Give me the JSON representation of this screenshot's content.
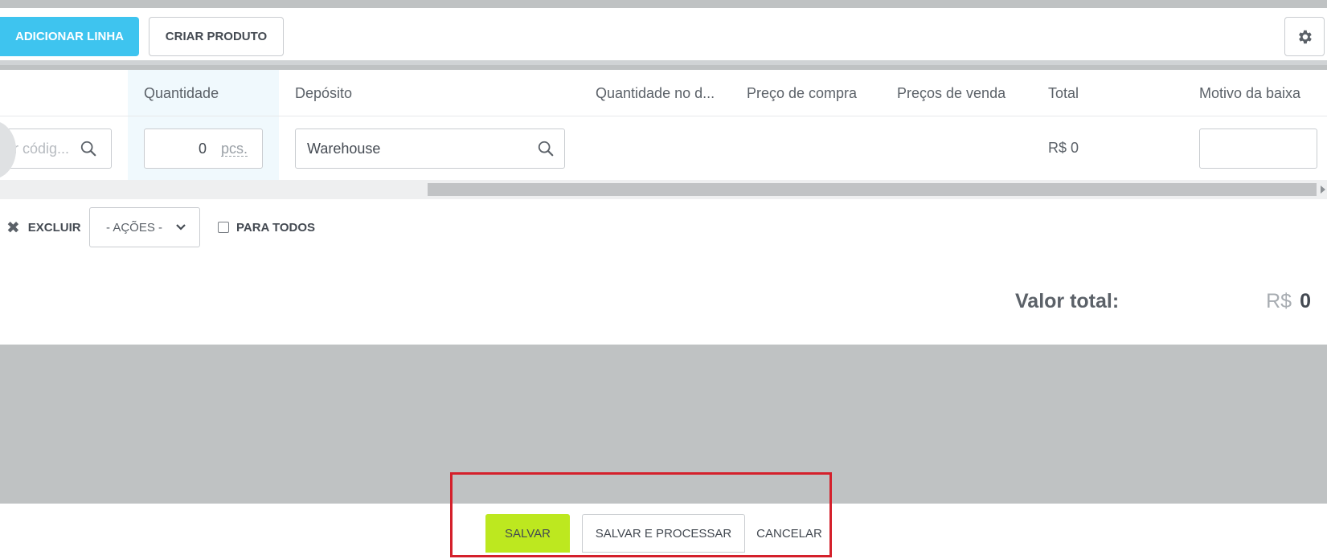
{
  "toolbar": {
    "add_line_label": "ADICIONAR LINHA",
    "create_product_label": "CRIAR PRODUTO",
    "settings_icon": "gear-icon"
  },
  "table": {
    "columns": [
      "Quantidade",
      "Depósito",
      "Quantidade no d...",
      "Preço de compra",
      "Preços de venda",
      "Total",
      "Motivo da baixa"
    ],
    "row": {
      "product_search_placeholder": "por códig...",
      "quantity_value": "0",
      "quantity_unit": "pcs.",
      "deposit_value": "Warehouse",
      "total": "R$ 0",
      "reason_value": ""
    }
  },
  "actions": {
    "delete_label": "EXCLUIR",
    "actions_select_label": "- AÇÕES -",
    "apply_all_label": "PARA TODOS"
  },
  "summary": {
    "total_label": "Valor total:",
    "currency": "R$",
    "total_value": "0"
  },
  "footer": {
    "save_label": "SALVAR",
    "save_process_label": "SALVAR E PROCESSAR",
    "cancel_label": "CANCELAR"
  },
  "colors": {
    "accent_blue": "#3ec4ef",
    "accent_green": "#bde81f",
    "highlight_red": "#d4202b",
    "backdrop_gray": "#bfc2c3"
  }
}
